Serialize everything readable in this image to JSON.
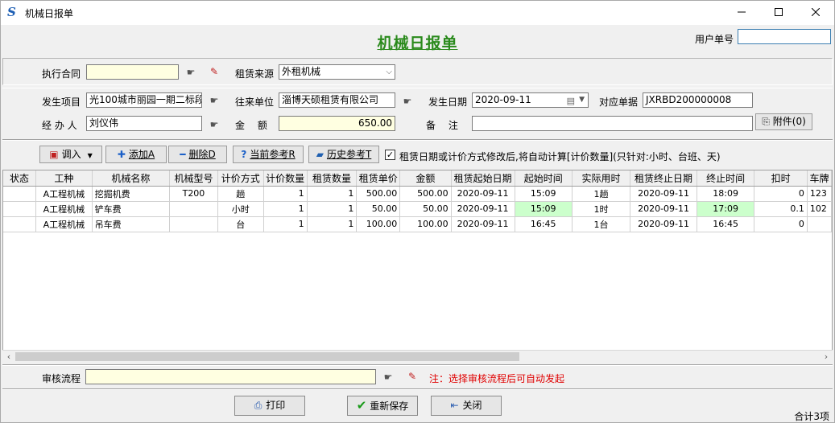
{
  "window": {
    "title": "机械日报单",
    "min_icon": "minimize-icon",
    "max_icon": "maximize-icon",
    "close_icon": "close-icon"
  },
  "heading": "机械日报单",
  "user_no": {
    "label": "用户单号",
    "value": ""
  },
  "row1": {
    "contract_label": "执行合同",
    "contract_value": "",
    "source_label": "租赁来源",
    "source_value": "外租机械"
  },
  "row2": {
    "project_label": "发生项目",
    "project_value": "光100城市丽园一期二标段",
    "unit_label": "往来单位",
    "unit_value": "淄博天硕租赁有限公司",
    "date_label": "发生日期",
    "date_value": "2020-09-11",
    "doc_label": "对应单据",
    "doc_value": "JXRBD200000008"
  },
  "row3": {
    "handler_label": "经 办 人",
    "handler_value": "刘仪伟",
    "amount_label": "金　 额",
    "amount_value": "650.00",
    "remark_label": "备　 注",
    "remark_value": "",
    "attach_label": "附件(0)"
  },
  "toolbar": {
    "import": "调入",
    "add": "添加A",
    "delete": "删除D",
    "current_ref": "当前参考R",
    "history_ref": "历史参考T",
    "auto_calc": "租赁日期或计价方式修改后,将自动计算[计价数量](只针对:小时、台班、天)"
  },
  "table": {
    "columns": [
      "状态",
      "工种",
      "机械名称",
      "机械型号",
      "计价方式",
      "计价数量",
      "租赁数量",
      "租赁单价",
      "金额",
      "租赁起始日期",
      "起始时间",
      "实际用时",
      "租赁终止日期",
      "终止时间",
      "扣时",
      "车牌"
    ],
    "rows": [
      [
        "",
        "A工程机械",
        "挖掘机费",
        "T200",
        "趟",
        "1",
        "1",
        "500.00",
        "500.00",
        "2020-09-11",
        "15:09",
        "1趟",
        "2020-09-11",
        "18:09",
        "0",
        "123"
      ],
      [
        "",
        "A工程机械",
        "铲车费",
        "",
        "小时",
        "1",
        "1",
        "50.00",
        "50.00",
        "2020-09-11",
        "15:09",
        "1时",
        "2020-09-11",
        "17:09",
        "0.1",
        "102"
      ],
      [
        "",
        "A工程机械",
        "吊车费",
        "",
        "台",
        "1",
        "1",
        "100.00",
        "100.00",
        "2020-09-11",
        "16:45",
        "1台",
        "2020-09-11",
        "16:45",
        "0",
        ""
      ]
    ]
  },
  "review": {
    "label": "审核流程",
    "value": "",
    "note": "注：选择审核流程后可自动发起"
  },
  "buttons": {
    "print": "打印",
    "resave": "重新保存",
    "close": "关闭"
  },
  "status": "合计3项",
  "colors": {
    "heading": "#2a8a1c",
    "yellow_field": "#ffffe1",
    "highlight": "#ccffcc",
    "note": "#e00000"
  }
}
